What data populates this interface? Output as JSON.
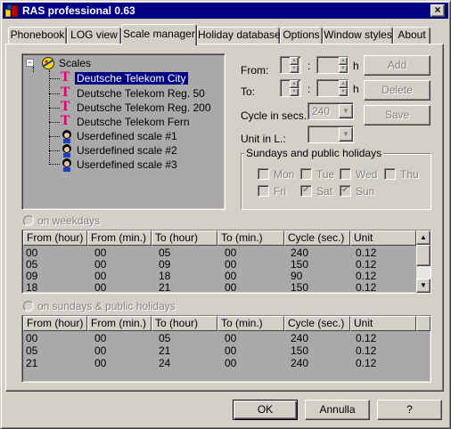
{
  "window": {
    "title": "RAS professional 0.63"
  },
  "tabs": [
    {
      "label": "Phonebook"
    },
    {
      "label": "LOG view"
    },
    {
      "label": "Scale manager"
    },
    {
      "label": "Holiday database"
    },
    {
      "label": "Options"
    },
    {
      "label": "Window styles"
    },
    {
      "label": "About"
    }
  ],
  "tree": {
    "root": "Scales",
    "items": [
      {
        "label": "Deutsche Telekom City",
        "icon": "telekom-icon",
        "selected": true
      },
      {
        "label": "Deutsche Telekom Reg. 50",
        "icon": "telekom-icon"
      },
      {
        "label": "Deutsche Telekom Reg. 200",
        "icon": "telekom-icon"
      },
      {
        "label": "Deutsche Telekom Fern",
        "icon": "telekom-icon"
      },
      {
        "label": "Userdefined scale #1",
        "icon": "user-icon"
      },
      {
        "label": "Userdefined scale #2",
        "icon": "user-icon"
      },
      {
        "label": "Userdefined scale #3",
        "icon": "user-icon"
      }
    ]
  },
  "form": {
    "from_label": "From:",
    "to_label": "To:",
    "colon": ":",
    "h_unit": "h",
    "cycle_label": "Cycle in secs.",
    "cycle_value": "240",
    "unit_label": "Unit in L.:",
    "unit_value": "",
    "add_button": "Add",
    "delete_button": "Delete",
    "save_button": "Save"
  },
  "holidays_group": {
    "title": "Sundays and public holidays",
    "days": [
      {
        "label": "Mon",
        "checked": false
      },
      {
        "label": "Tue",
        "checked": false
      },
      {
        "label": "Wed",
        "checked": false
      },
      {
        "label": "Thu",
        "checked": false
      },
      {
        "label": "Fri",
        "checked": false
      },
      {
        "label": "Sat",
        "checked": true
      },
      {
        "label": "Sun",
        "checked": true
      }
    ]
  },
  "weekdays": {
    "radio_label": "on weekdays",
    "columns": [
      "From (hour)",
      "From (min.)",
      "To (hour)",
      "To (min.)",
      "Cycle (sec.)",
      "Unit"
    ],
    "rows": [
      [
        "00",
        "00",
        "05",
        "00",
        "240",
        "0.12"
      ],
      [
        "05",
        "00",
        "09",
        "00",
        "150",
        "0.12"
      ],
      [
        "09",
        "00",
        "18",
        "00",
        "90",
        "0.12"
      ],
      [
        "18",
        "00",
        "21",
        "00",
        "150",
        "0.12"
      ]
    ]
  },
  "holidays": {
    "radio_label": "on sundays & public holidays",
    "columns": [
      "From (hour)",
      "From (min.)",
      "To (hour)",
      "To (min.)",
      "Cycle (sec.)",
      "Unit"
    ],
    "rows": [
      [
        "00",
        "00",
        "05",
        "00",
        "240",
        "0.12"
      ],
      [
        "05",
        "00",
        "21",
        "00",
        "150",
        "0.12"
      ],
      [
        "21",
        "00",
        "24",
        "00",
        "240",
        "0.12"
      ]
    ]
  },
  "footer": {
    "ok_button": "OK",
    "cancel_button": "Annulla",
    "help_button": "?"
  },
  "colors": {
    "titlebar": "#000080",
    "face": "#d4d0c8",
    "content_bg": "#a9a9a9",
    "telekom_magenta": "#e20074"
  }
}
